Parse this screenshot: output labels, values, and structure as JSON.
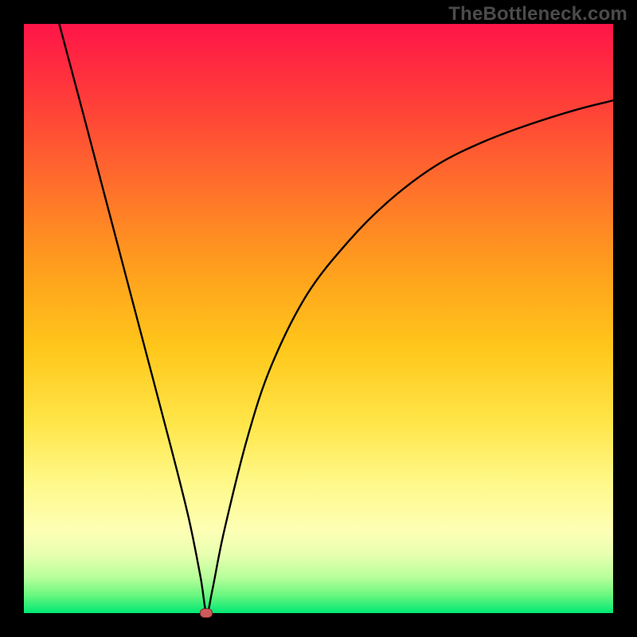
{
  "watermark": "TheBottleneck.com",
  "chart_data": {
    "type": "line",
    "title": "",
    "xlabel": "",
    "ylabel": "",
    "xlim": [
      0,
      100
    ],
    "ylim": [
      0,
      100
    ],
    "grid": false,
    "legend": false,
    "series": [
      {
        "name": "curve",
        "x": [
          6,
          10,
          15,
          20,
          25,
          28,
          30,
          31,
          32,
          34,
          38,
          42,
          48,
          55,
          62,
          70,
          78,
          86,
          94,
          100
        ],
        "y": [
          100,
          85,
          66,
          47,
          28,
          16,
          6,
          0,
          4,
          14,
          30,
          42,
          54,
          63,
          70,
          76,
          80,
          83,
          85.5,
          87
        ]
      }
    ],
    "marker": {
      "x": 31,
      "y": 0,
      "color": "#d05a5a"
    },
    "background_gradient": {
      "top": "#ff1548",
      "mid_upper": "#ff9a1e",
      "mid": "#ffe64a",
      "mid_lower": "#fdffb5",
      "bottom": "#00e874"
    }
  }
}
